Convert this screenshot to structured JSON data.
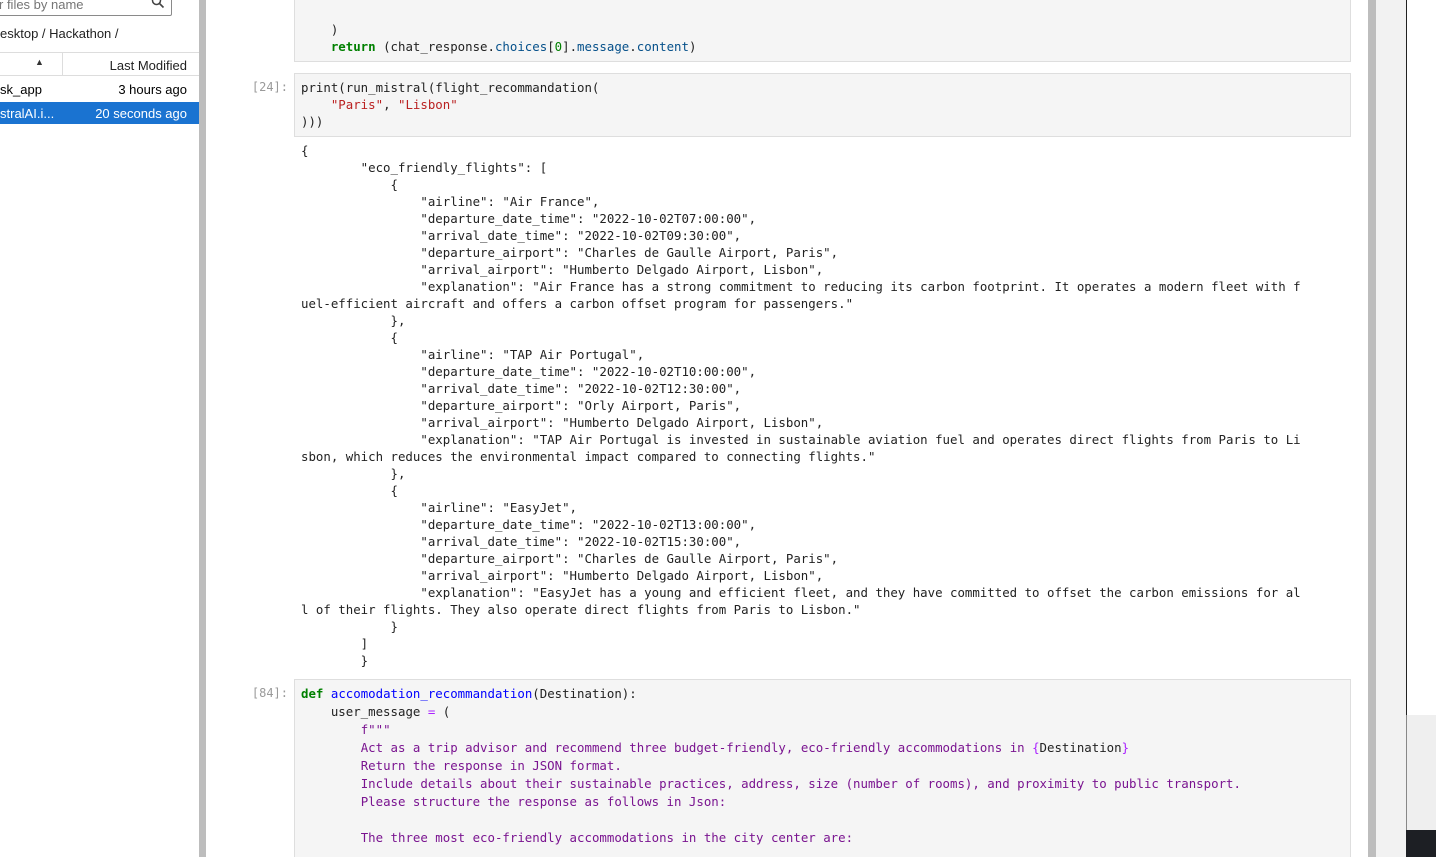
{
  "sidebar": {
    "filter_placeholder": "r files by name",
    "breadcrumb": "esktop / Hackathon /",
    "header": {
      "sort_glyph": "▲",
      "last_modified": "Last Modified"
    },
    "files": [
      {
        "name": "sk_app",
        "modified": "3 hours ago",
        "selected": false
      },
      {
        "name": "stralAI.i...",
        "modified": "20 seconds ago",
        "selected": true
      }
    ]
  },
  "notebook": {
    "prompts": {
      "cell_24": "[24]:",
      "cell_84": "[84]:"
    },
    "output_text": "{\n        \"eco_friendly_flights\": [\n            {\n                \"airline\": \"Air France\",\n                \"departure_date_time\": \"2022-10-02T07:00:00\",\n                \"arrival_date_time\": \"2022-10-02T09:30:00\",\n                \"departure_airport\": \"Charles de Gaulle Airport, Paris\",\n                \"arrival_airport\": \"Humberto Delgado Airport, Lisbon\",\n                \"explanation\": \"Air France has a strong commitment to reducing its carbon footprint. It operates a modern fleet with f\nuel-efficient aircraft and offers a carbon offset program for passengers.\"\n            },\n            {\n                \"airline\": \"TAP Air Portugal\",\n                \"departure_date_time\": \"2022-10-02T10:00:00\",\n                \"arrival_date_time\": \"2022-10-02T12:30:00\",\n                \"departure_airport\": \"Orly Airport, Paris\",\n                \"arrival_airport\": \"Humberto Delgado Airport, Lisbon\",\n                \"explanation\": \"TAP Air Portugal is invested in sustainable aviation fuel and operates direct flights from Paris to Li\nsbon, which reduces the environmental impact compared to connecting flights.\"\n            },\n            {\n                \"airline\": \"EasyJet\",\n                \"departure_date_time\": \"2022-10-02T13:00:00\",\n                \"arrival_date_time\": \"2022-10-02T15:30:00\",\n                \"departure_airport\": \"Charles de Gaulle Airport, Paris\",\n                \"arrival_airport\": \"Humberto Delgado Airport, Lisbon\",\n                \"explanation\": \"EasyJet has a young and efficient fleet, and they have committed to offset the carbon emissions for al\nl of their flights. They also operate direct flights from Paris to Lisbon.\"\n            }\n        ]\n        }"
  },
  "code": {
    "c0_paren": ")",
    "c0_return": "return",
    "c0_rest_a": " (chat_response.",
    "c0_choices": "choices",
    "c0_lb": "[",
    "c0_idx": "0",
    "c0_rb": "].",
    "c0_message": "message",
    "c0_dot": ".",
    "c0_content": "content",
    "c0_close": ")",
    "c1_line1": "print(run_mistral(flight_recommandation(",
    "c1_paris": "\"Paris\"",
    "c1_comma": ", ",
    "c1_lisbon": "\"Lisbon\"",
    "c1_line3": ")))",
    "c2_def": "def",
    "c2_fname": "accomodation_recommandation",
    "c2_args": "(Destination):",
    "c2_um": "user_message",
    "c2_eq": "=",
    "c2_paren": "(",
    "c2_f": "f\"\"\"",
    "c2_l1a": "Act as a trip advisor and recommend three budget-friendly, eco-friendly accommodations in ",
    "c2_l1b": "{",
    "c2_l1c": "Destination",
    "c2_l1d": "}",
    "c2_l2": "Return the response in JSON format.",
    "c2_l3": "Include details about their sustainable practices, address, size (number of rooms), and proximity to public transport.",
    "c2_l4": "Please structure the response as follows in Json:",
    "c2_l6": "The three most eco-friendly accommodations in the city center are:"
  },
  "colors": {
    "selection": "#1a73d1",
    "keyword": "#008000",
    "string": "#ba2121",
    "docstring": "#7a1490"
  }
}
